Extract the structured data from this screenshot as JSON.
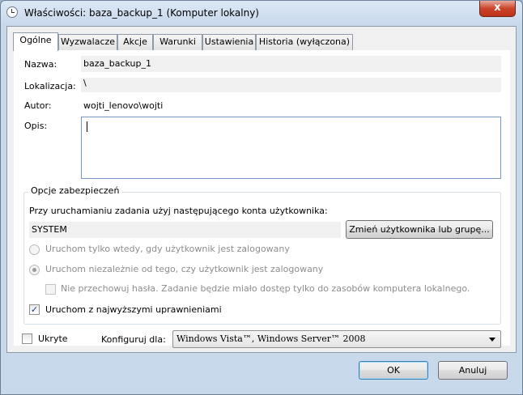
{
  "window": {
    "title": "Właściwości: baza_backup_1 (Komputer lokalny)",
    "close_glyph": "x"
  },
  "tabs": [
    {
      "label": "Ogólne",
      "active": true
    },
    {
      "label": "Wyzwalacze",
      "active": false
    },
    {
      "label": "Akcje",
      "active": false
    },
    {
      "label": "Warunki",
      "active": false
    },
    {
      "label": "Ustawienia",
      "active": false
    },
    {
      "label": "Historia (wyłączona)",
      "active": false
    }
  ],
  "general": {
    "name_label": "Nazwa:",
    "name_value": "baza_backup_1",
    "location_label": "Lokalizacja:",
    "location_value": "\\",
    "author_label": "Autor:",
    "author_value": "wojti_lenovo\\wojti",
    "description_label": "Opis:",
    "description_value": ""
  },
  "security": {
    "legend": "Opcje zabezpieczeń",
    "account_prompt": "Przy uruchamianiu zadania użyj następującego konta użytkownika:",
    "account_value": "SYSTEM",
    "change_user_button": "Zmień użytkownika lub grupę...",
    "run_logged_on_label": "Uruchom tylko wtedy, gdy użytkownik jest zalogowany",
    "run_logged_on_selected": false,
    "run_whether_label": "Uruchom niezależnie od tego, czy użytkownik jest zalogowany",
    "run_whether_selected": true,
    "no_store_password_label": "Nie przechowuj hasła. Zadanie będzie miało dostęp tylko do zasobów komputera lokalnego.",
    "no_store_password_checked": false,
    "highest_privileges_label": "Uruchom z najwyższymi uprawnieniami",
    "highest_privileges_checked": true
  },
  "footer": {
    "hidden_label": "Ukryte",
    "hidden_checked": false,
    "configure_label": "Konfiguruj dla:",
    "configure_value": "Windows Vista™, Windows Server™ 2008"
  },
  "buttons": {
    "ok": "OK",
    "cancel": "Anuluj"
  }
}
